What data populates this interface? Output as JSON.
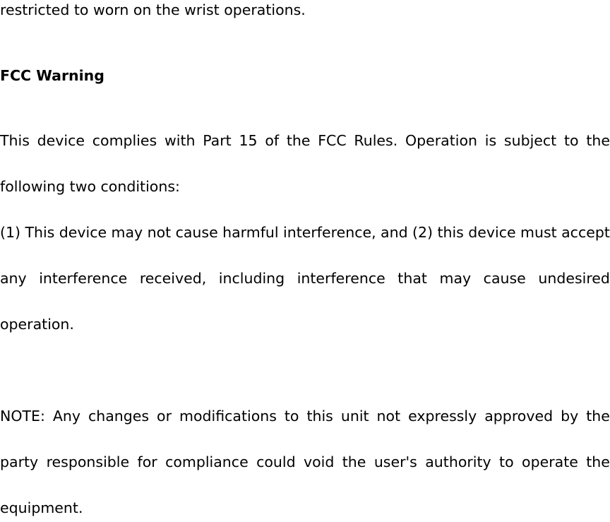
{
  "document": {
    "page_background": "#ffffff",
    "text_color": "#000000",
    "body": {
      "lines": [
        {
          "id": "restricted",
          "text": "restricted to worn on the wrist operations.",
          "alignment": "flush",
          "style": "regular"
        },
        {
          "id": "heading_fcc_warning",
          "text": "FCC Warning",
          "alignment": "flush",
          "style": "bold"
        },
        {
          "id": "this_device_complies",
          "text": "This device complies with Part 15 of the FCC Rules. Operation is subject to the",
          "alignment": "justify",
          "style": "regular",
          "words": [
            "This",
            "device",
            "complies",
            "with",
            "Part",
            "15",
            "of",
            "the",
            "FCC",
            "Rules.",
            "Operation",
            "is",
            "subject",
            "to",
            "the"
          ]
        },
        {
          "id": "following_two_conditions",
          "text": "following two conditions:",
          "alignment": "flush",
          "style": "regular"
        },
        {
          "id": "condition_one",
          "text": "(1) This device may not cause harmful interference, and (2) this device must accept",
          "alignment": "justify",
          "style": "regular",
          "words": [
            "(1)",
            "This",
            "device",
            "may",
            "not",
            "cause",
            "harmful",
            "interference,",
            "and",
            "(2)",
            "this",
            "device",
            "must",
            "accept"
          ]
        },
        {
          "id": "any_interference",
          "text": "any interference received, including interference that may cause undesired",
          "alignment": "justify",
          "style": "regular",
          "words": [
            "any",
            "interference",
            "received,",
            "including",
            "interference",
            "that",
            "may",
            "cause",
            "undesired"
          ]
        },
        {
          "id": "operation",
          "text": "operation.",
          "alignment": "flush",
          "style": "regular"
        },
        {
          "id": "note_line_one",
          "text": "NOTE: Any changes or modifications to this unit not expressly approved by the",
          "alignment": "justify",
          "style": "regular",
          "words": [
            "NOTE:",
            "Any",
            "changes",
            "or",
            "modifications",
            "to",
            "this",
            "unit",
            "not",
            "expressly",
            "approved",
            "by",
            "the"
          ]
        },
        {
          "id": "note_line_two",
          "text": "party responsible for compliance could void the user's authority to operate the",
          "alignment": "justify",
          "style": "regular",
          "words": [
            "party",
            "responsible",
            "for",
            "compliance",
            "could",
            "void",
            "the",
            "user's",
            "authority",
            "to",
            "operate",
            "the"
          ]
        },
        {
          "id": "note_line_three",
          "text": "equipment.",
          "alignment": "flush",
          "style": "regular"
        }
      ]
    },
    "paragraphs": {
      "fragment_top": "restricted to worn on the wrist operations.",
      "heading": "FCC Warning",
      "compliance_statement": "This device complies with Part 15 of the FCC Rules. Operation is subject to the following two conditions:",
      "conditions": "(1) This device may not cause harmful interference, and (2) this device must accept any interference received, including interference that may cause undesired operation.",
      "note": "NOTE: Any changes or modifications to this unit not expressly approved by the party responsible for compliance could void the user's authority to operate the equipment."
    }
  }
}
